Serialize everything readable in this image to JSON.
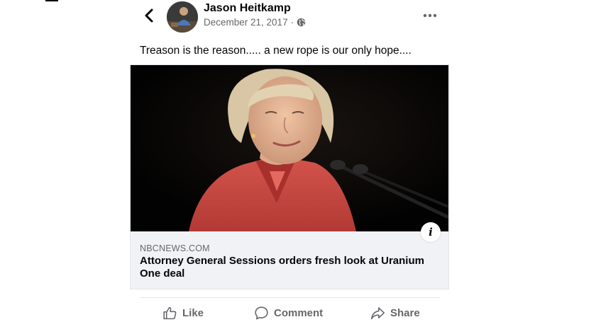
{
  "post": {
    "author": "Jason Heitkamp",
    "date": "December 21, 2017",
    "separator": "·",
    "privacy_icon": "globe-icon",
    "text": "Treason is the reason..... a new rope is our only hope...."
  },
  "header": {
    "back_icon": "chevron-left-icon",
    "more_icon": "more-horizontal-icon"
  },
  "link_preview": {
    "domain": "NBCNEWS.COM",
    "title": "Attorney General Sessions orders fresh look at Uranium One deal",
    "info_label": "i"
  },
  "actions": {
    "like": "Like",
    "comment": "Comment",
    "share": "Share"
  },
  "colors": {
    "text_primary": "#050505",
    "text_secondary": "#65676b",
    "card_background": "#f0f2f5",
    "divider": "#e4e6eb"
  }
}
